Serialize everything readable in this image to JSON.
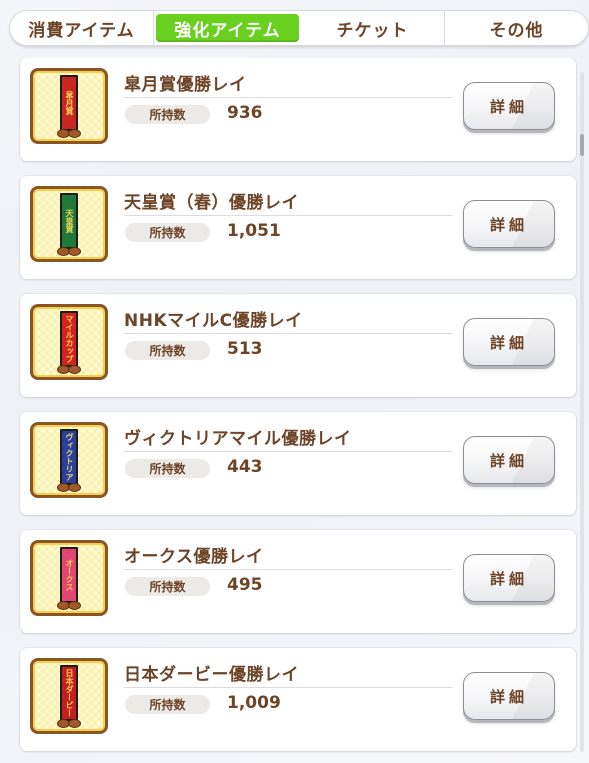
{
  "tabs": [
    {
      "label": "消費アイテム",
      "active": false
    },
    {
      "label": "強化アイテム",
      "active": true
    },
    {
      "label": "チケット",
      "active": false
    },
    {
      "label": "その他",
      "active": false
    }
  ],
  "owned_label": "所持数",
  "detail_label": "詳細",
  "items": [
    {
      "name": "皐月賞優勝レイ",
      "count": "936",
      "sash_color": "#c8261f",
      "sash_text": "皐月賞"
    },
    {
      "name": "天皇賞（春）優勝レイ",
      "count": "1,051",
      "sash_color": "#1f7a3a",
      "sash_text": "天皇賞"
    },
    {
      "name": "NHKマイルC優勝レイ",
      "count": "513",
      "sash_color": "#d4231d",
      "sash_text": "マイルカップ"
    },
    {
      "name": "ヴィクトリアマイル優勝レイ",
      "count": "443",
      "sash_color": "#2b3f9e",
      "sash_text": "ヴィクトリア"
    },
    {
      "name": "オークス優勝レイ",
      "count": "495",
      "sash_color": "#e2456f",
      "sash_text": "オークス"
    },
    {
      "name": "日本ダービー優勝レイ",
      "count": "1,009",
      "sash_color": "#c41e1e",
      "sash_text": "日本ダービー"
    }
  ],
  "colors": {
    "text_brown": "#6d4427",
    "tab_active": "#6ad01f",
    "thumb_border": "#8a5424"
  }
}
